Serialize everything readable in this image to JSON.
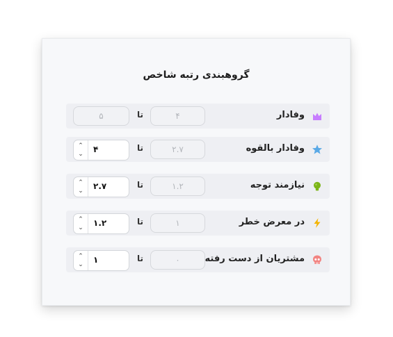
{
  "title": "گروهبندی رتبه شاخص",
  "rows": [
    {
      "label": "وفادار",
      "from": "۴",
      "to": "۵",
      "to_editable": false,
      "icon": "crown-icon",
      "icon_color": "#c77dff"
    },
    {
      "label": "وفادار بالقوه",
      "from": "۲.۷",
      "to": "۴",
      "to_editable": true,
      "icon": "star-icon",
      "icon_color": "#5aa9e6"
    },
    {
      "label": "نیازمند توجه",
      "from": "۱.۲",
      "to": "۲.۷",
      "to_editable": true,
      "icon": "bulb-icon",
      "icon_color": "#7cb518"
    },
    {
      "label": "در معرض خطر",
      "from": "۱",
      "to": "۱.۲",
      "to_editable": true,
      "icon": "bolt-icon",
      "icon_color": "#f4b400"
    },
    {
      "label": "مشتریان از دست رفته",
      "from": "۰",
      "to": "۱",
      "to_editable": true,
      "icon": "skull-icon",
      "icon_color": "#f28482"
    }
  ],
  "separator": "تا"
}
